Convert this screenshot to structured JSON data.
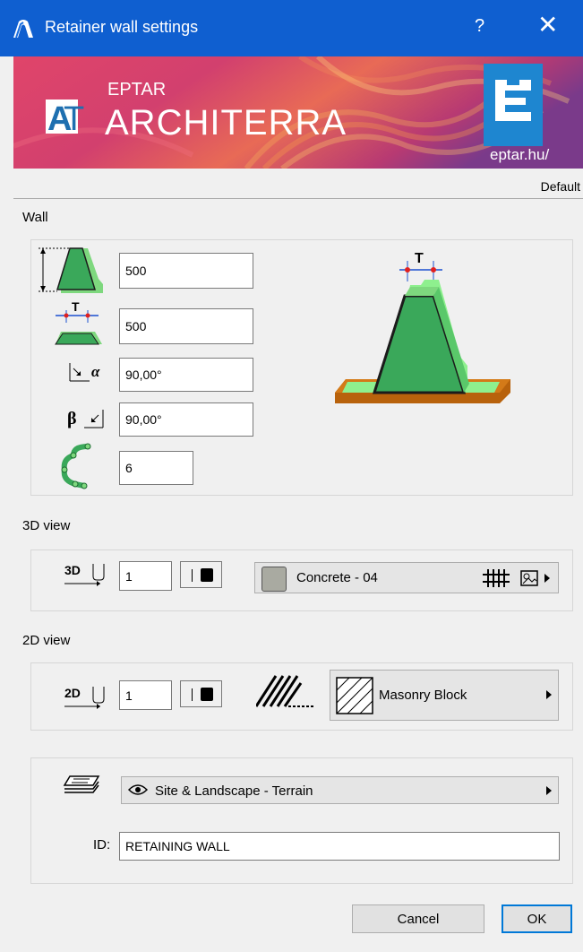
{
  "window": {
    "title": "Retainer wall settings",
    "help": "?",
    "close": "✕"
  },
  "banner": {
    "eptar": "EPTAR",
    "at": "AT",
    "architerra": "ARCHITERRA",
    "site": "eptar.hu/"
  },
  "profile": "Default",
  "wall": {
    "label": "Wall",
    "height": "500",
    "top_width": "500",
    "alpha": "90,00°",
    "beta": "90,00°",
    "segments": "6",
    "preview_label": "T"
  },
  "view3d": {
    "label": "3D view",
    "icon_text": "3D",
    "pen": "1",
    "material": "Concrete - 04",
    "material_swatch": "#a9aaa1"
  },
  "view2d": {
    "label": "2D view",
    "icon_text": "2D",
    "pen": "1",
    "fill": "Masonry Block"
  },
  "layer": {
    "name": "Site & Landscape - Terrain"
  },
  "id": {
    "label": "ID:",
    "value": "RETAINING WALL"
  },
  "buttons": {
    "cancel": "Cancel",
    "ok": "OK"
  }
}
